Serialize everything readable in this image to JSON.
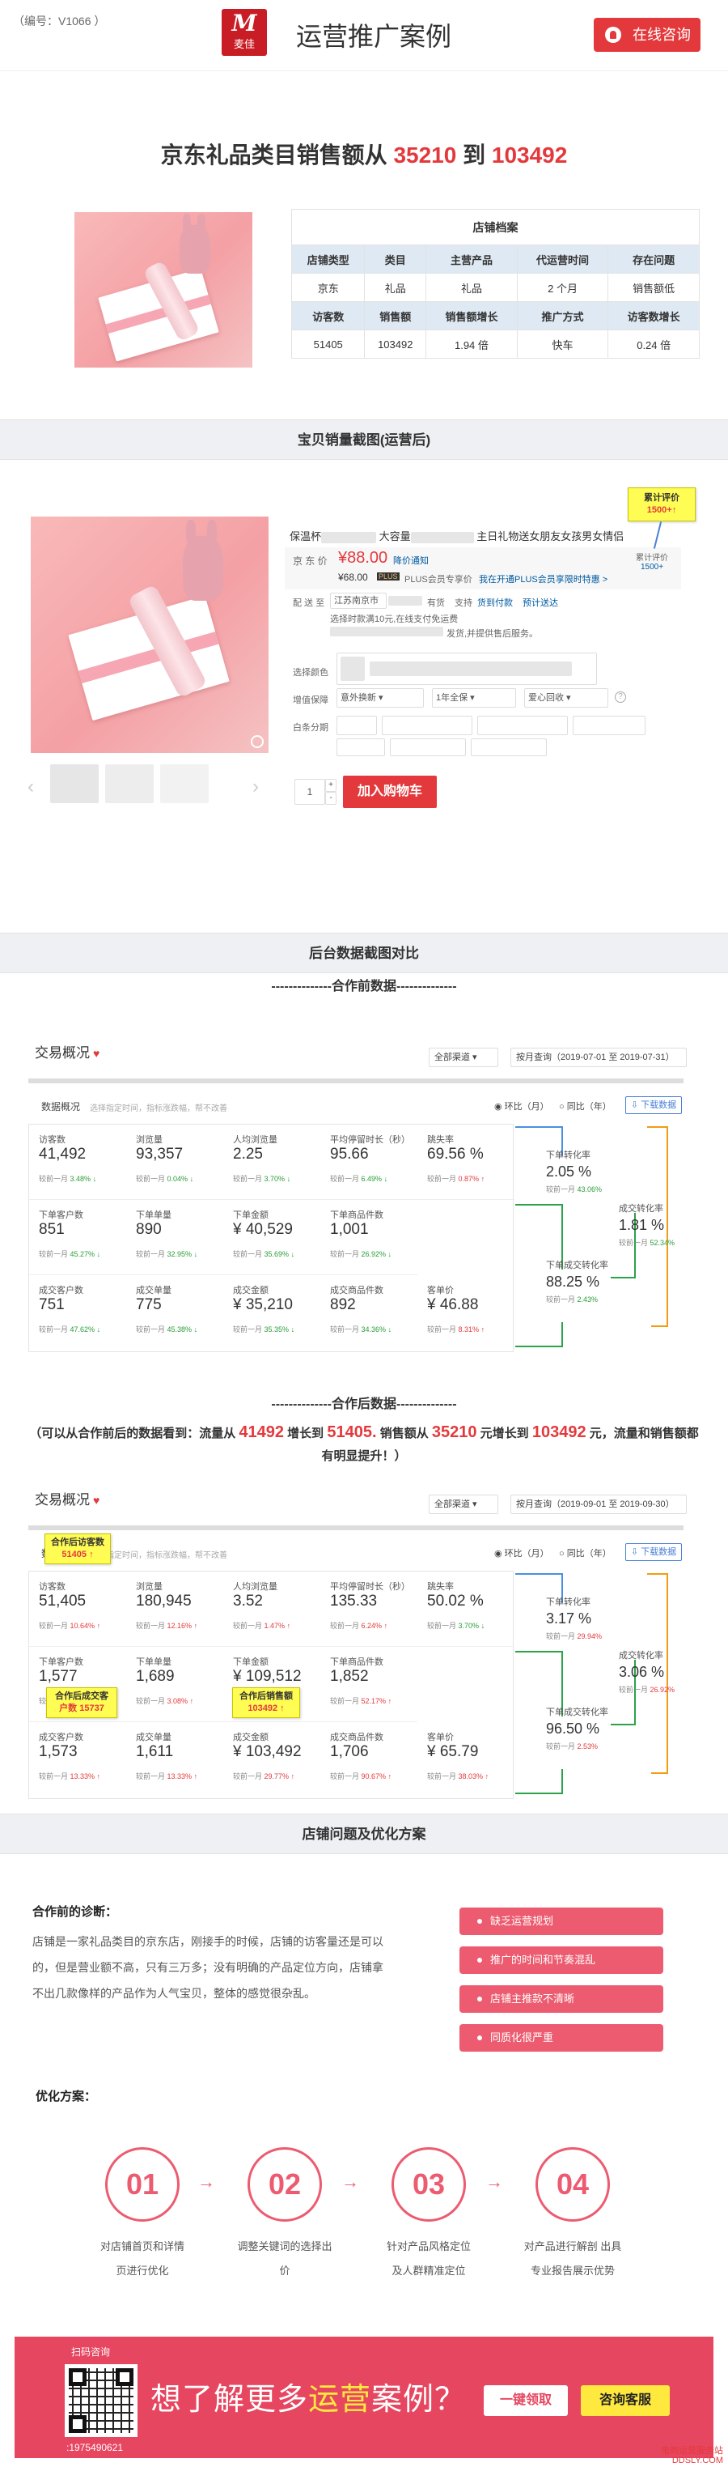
{
  "header": {
    "code": "（编号：V1066 ）",
    "logo_mark": "M",
    "logo_text": "麦佳",
    "title": "运营推广案例",
    "consult_btn": "在线咨询"
  },
  "headline": {
    "prefix": "京东礼品类目销售额从 ",
    "from": "35210",
    "mid": " 到 ",
    "to": "103492"
  },
  "store_table": {
    "caption": "店铺档案",
    "row1_headers": [
      "店铺类型",
      "类目",
      "主营产品",
      "代运营时间",
      "存在问题"
    ],
    "row1_values": [
      "京东",
      "礼品",
      "礼品",
      "2 个月",
      "销售额低"
    ],
    "row2_headers": [
      "访客数",
      "销售额",
      "销售额增长",
      "推广方式",
      "访客数增长"
    ],
    "row2_values": [
      "51405",
      "103492",
      "1.94 倍",
      "快车",
      "0.24 倍"
    ]
  },
  "section_sales": "宝贝销量截图(运营后)",
  "product": {
    "title_parts": [
      "保温杯",
      "大容量",
      "主日礼物送女朋友女孩男女情侣"
    ],
    "jd_price_label": "京 东 价",
    "price": "¥88.00",
    "notify": "降价通知",
    "plus_price": "¥68.00",
    "plus_badge": "PLUS",
    "plus_text": "PLUS会员专享价",
    "plus_link": "我在开通PLUS会员享限时特惠 >",
    "review_label": "累计评价",
    "review_count": "1500+",
    "delivery_label": "配 送 至",
    "delivery_text": "江苏南京市",
    "stock": "有货",
    "support": "支持",
    "service1": "货到付款",
    "service2": "选择指定",
    "service3": "预计送达",
    "delivery_note2": "选择时款满10元,在线支付免运费",
    "delivery_note3": "发货,并提供售后服务。",
    "color_label": "选择颜色",
    "warranty_label": "增值保障",
    "warranty_opt1": "意外换新",
    "warranty_opt2": "1年全保",
    "warranty_opt3": "爱心回收",
    "installment_label": "白条分期",
    "qty": "1",
    "add_cart": "加入购物车"
  },
  "annotation_review": {
    "line1": "累计评价",
    "line2": "1500+↑"
  },
  "section_backend": "后台数据截图对比",
  "before_title": "--------------合作前数据--------------",
  "after_title": "--------------合作后数据--------------",
  "dash_common": {
    "title": "交易概况",
    "channel": "全部渠道",
    "overview": "数据概况",
    "overview_hint": "选择指定时间，指标涨跌幅，帮不改善",
    "radio1": "环比（月）",
    "radio2": "同比（年）",
    "download": "下载数据"
  },
  "before": {
    "date": "按月查询（2019-07-01 至 2019-07-31）",
    "rows": [
      [
        {
          "l": "访客数",
          "v": "41,492",
          "c": "较前一月",
          "p": "3.48%",
          "d": "dn"
        },
        {
          "l": "浏览量",
          "v": "93,357",
          "c": "较前一月",
          "p": "0.04%",
          "d": "dn"
        },
        {
          "l": "人均浏览量",
          "v": "2.25",
          "c": "较前一月",
          "p": "3.70%",
          "d": "dn"
        },
        {
          "l": "平均停留时长（秒）",
          "v": "95.66",
          "c": "较前一月",
          "p": "6.49%",
          "d": "dn"
        },
        {
          "l": "跳失率",
          "v": "69.56 %",
          "c": "较前一月",
          "p": "0.87%",
          "d": "up"
        }
      ],
      [
        {
          "l": "下单客户数",
          "v": "851",
          "c": "较前一月",
          "p": "45.27%",
          "d": "dn"
        },
        {
          "l": "下单单量",
          "v": "890",
          "c": "较前一月",
          "p": "32.95%",
          "d": "dn"
        },
        {
          "l": "下单金额",
          "v": "¥ 40,529",
          "c": "较前一月",
          "p": "35.69%",
          "d": "dn"
        },
        {
          "l": "下单商品件数",
          "v": "1,001",
          "c": "较前一月",
          "p": "26.92%",
          "d": "dn"
        }
      ],
      [
        {
          "l": "成交客户数",
          "v": "751",
          "c": "较前一月",
          "p": "47.62%",
          "d": "dn"
        },
        {
          "l": "成交单量",
          "v": "775",
          "c": "较前一月",
          "p": "45.38%",
          "d": "dn"
        },
        {
          "l": "成交金额",
          "v": "¥ 35,210",
          "c": "较前一月",
          "p": "35.35%",
          "d": "dn"
        },
        {
          "l": "成交商品件数",
          "v": "892",
          "c": "较前一月",
          "p": "34.36%",
          "d": "dn"
        },
        {
          "l": "客单价",
          "v": "¥ 46.88",
          "c": "较前一月",
          "p": "8.31%",
          "d": "up"
        }
      ]
    ],
    "funnel": [
      {
        "l": "下单转化率",
        "v": "2.05 %",
        "c": "较前一月",
        "p": "43.06%",
        "d": "dn"
      },
      {
        "l": "成交转化率",
        "v": "1.81 %",
        "c": "较前一月",
        "p": "52.34%",
        "d": "dn"
      },
      {
        "l": "下单成交转化率",
        "v": "88.25 %",
        "c": "较前一月",
        "p": "2.43%",
        "d": "dn"
      }
    ]
  },
  "after": {
    "date": "按月查询（2019-09-01 至 2019-09-30）",
    "rows": [
      [
        {
          "l": "访客数",
          "v": "51,405",
          "c": "较前一月",
          "p": "10.64%",
          "d": "up"
        },
        {
          "l": "浏览量",
          "v": "180,945",
          "c": "较前一月",
          "p": "12.16%",
          "d": "up"
        },
        {
          "l": "人均浏览量",
          "v": "3.52",
          "c": "较前一月",
          "p": "1.47%",
          "d": "up"
        },
        {
          "l": "平均停留时长（秒）",
          "v": "135.33",
          "c": "较前一月",
          "p": "6.24%",
          "d": "up"
        },
        {
          "l": "跳失率",
          "v": "50.02 %",
          "c": "较前一月",
          "p": "3.70%",
          "d": "dn"
        }
      ],
      [
        {
          "l": "下单客户数",
          "v": "1,577",
          "c": "较前一月",
          "p": "3.08%",
          "d": "up"
        },
        {
          "l": "下单单量",
          "v": "1,689",
          "c": "较前一月",
          "p": "3.08%",
          "d": "up"
        },
        {
          "l": "下单金额",
          "v": "¥ 109,512",
          "c": "较前一月",
          "p": "29.77%",
          "d": "up"
        },
        {
          "l": "下单商品件数",
          "v": "1,852",
          "c": "较前一月",
          "p": "52.17%",
          "d": "up"
        }
      ],
      [
        {
          "l": "成交客户数",
          "v": "1,573",
          "c": "较前一月",
          "p": "13.33%",
          "d": "up"
        },
        {
          "l": "成交单量",
          "v": "1,611",
          "c": "较前一月",
          "p": "13.33%",
          "d": "up"
        },
        {
          "l": "成交金额",
          "v": "¥ 103,492",
          "c": "较前一月",
          "p": "29.77%",
          "d": "up"
        },
        {
          "l": "成交商品件数",
          "v": "1,706",
          "c": "较前一月",
          "p": "90.67%",
          "d": "up"
        },
        {
          "l": "客单价",
          "v": "¥ 65.79",
          "c": "较前一月",
          "p": "38.03%",
          "d": "up"
        }
      ]
    ],
    "funnel": [
      {
        "l": "下单转化率",
        "v": "3.17 %",
        "c": "较前一月",
        "p": "29.94%",
        "d": "up"
      },
      {
        "l": "成交转化率",
        "v": "3.06 %",
        "c": "较前一月",
        "p": "26.92%",
        "d": "up"
      },
      {
        "l": "下单成交转化率",
        "v": "96.50 %",
        "c": "较前一月",
        "p": "2.53%",
        "d": "up"
      }
    ],
    "notes": {
      "visitors": [
        "合作后访客数",
        "51405 ↑"
      ],
      "customers": [
        "合作后成交客",
        "户数 15737"
      ],
      "amount": [
        "合作后销售额",
        "103492 ↑"
      ]
    }
  },
  "summary": {
    "p1": "（可以从合作前后的数据看到：流量从 ",
    "v1": "41492",
    "p2": " 增长到 ",
    "v2": "51405.",
    "p3": " 销售额从 ",
    "v3": "35210",
    "p4": " 元增长到 ",
    "v4": "103492",
    "p5": " 元，流量和销售额都有明显提升！）"
  },
  "section_issues": "店铺问题及优化方案",
  "diagnosis": {
    "title": "合作前的诊断：",
    "lines": [
      "店铺是一家礼品类目的京东店，刚接手的时候，店铺的访客量还是可以",
      "的，但是营业额不高，只有三万多；没有明确的产品定位方向，店铺拿",
      "不出几款像样的产品作为人气宝贝，整体的感觉很杂乱。"
    ]
  },
  "problems": [
    "缺乏运营规划",
    "推广的时间和节奏混乱",
    "店铺主推款不清晰",
    "同质化很严重"
  ],
  "plan": {
    "title": "优化方案：",
    "steps": [
      {
        "n": "01",
        "t1": "对店铺首页和详情",
        "t2": "页进行优化"
      },
      {
        "n": "02",
        "t1": "调整关键词的选择出",
        "t2": "价"
      },
      {
        "n": "03",
        "t1": "针对产品风格定位",
        "t2": "及人群精准定位"
      },
      {
        "n": "04",
        "t1": "对产品进行解剖 出具",
        "t2": "专业报告展示优势"
      }
    ]
  },
  "footer": {
    "scan": "扫码咨询",
    "phone": ":1975490621",
    "pre": "想了解更多",
    "hl": "运营",
    "post": "案例？",
    "btn1": "一键领取",
    "btn2": "咨询客服"
  },
  "watermark": {
    "l1": "电商运营服务站",
    "l2": "DDSLY.COM"
  },
  "colors": {
    "accent": "#e4393c",
    "pink": "#ec5b6f",
    "note_yellow": "#fffc54"
  }
}
